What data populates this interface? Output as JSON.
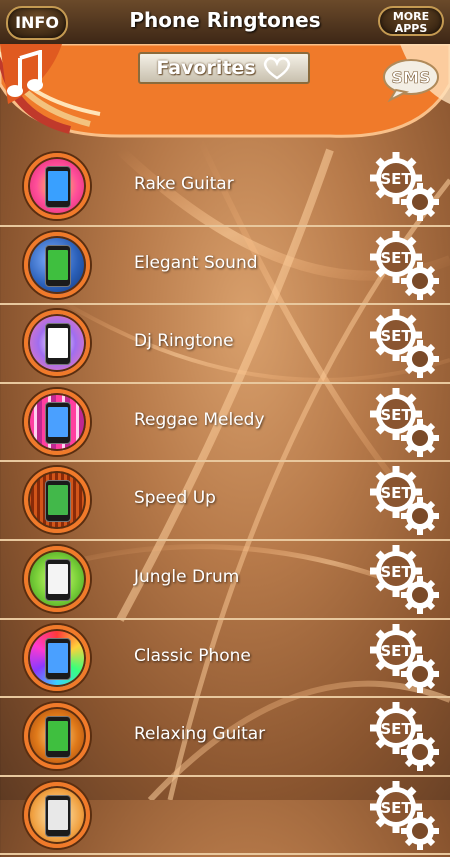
{
  "header": {
    "info_label": "INFO",
    "title": "Phone Ringtones",
    "more_apps_line1": "MORE",
    "more_apps_line2": "APPS",
    "favorites_label": "Favorites",
    "sms_label": "SMS"
  },
  "icons": [
    "music-note-icon",
    "heart-icon",
    "sms-bubble-icon",
    "set-gear-icon"
  ],
  "colors": {
    "accent": "#f07a2a",
    "header_bar": "#3d2716",
    "wood": "#b77a4a",
    "divider": "#e8c89e"
  },
  "ringtones": [
    {
      "name": "Rake Guitar",
      "set_label": "SET"
    },
    {
      "name": "Elegant Sound",
      "set_label": "SET"
    },
    {
      "name": "Dj Ringtone",
      "set_label": "SET"
    },
    {
      "name": "Reggae Meledy",
      "set_label": "SET"
    },
    {
      "name": "Speed Up",
      "set_label": "SET"
    },
    {
      "name": "Jungle Drum",
      "set_label": "SET"
    },
    {
      "name": "Classic Phone",
      "set_label": "SET"
    },
    {
      "name": "Relaxing Guitar",
      "set_label": "SET"
    },
    {
      "name": "",
      "set_label": "SET"
    }
  ]
}
